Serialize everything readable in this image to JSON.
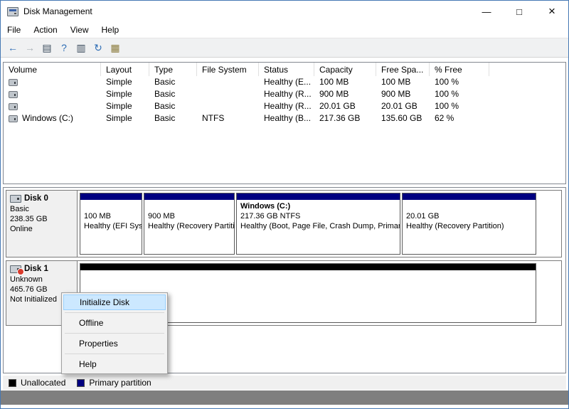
{
  "window": {
    "title": "Disk Management",
    "controls": {
      "minimize": "—",
      "maximize": "□",
      "close": "×"
    }
  },
  "menu_bar": {
    "items": [
      "File",
      "Action",
      "View",
      "Help"
    ]
  },
  "toolbar": {
    "icons": [
      {
        "name": "back",
        "glyph": "←"
      },
      {
        "name": "forward",
        "glyph": "→"
      },
      {
        "name": "show-console-tree",
        "glyph": "▤"
      },
      {
        "name": "help",
        "glyph": "?"
      },
      {
        "name": "show-action-pane",
        "glyph": "▥"
      },
      {
        "name": "refresh",
        "glyph": "↻"
      },
      {
        "name": "disk-properties",
        "glyph": "▦"
      }
    ]
  },
  "volume_table": {
    "columns": [
      "Volume",
      "Layout",
      "Type",
      "File System",
      "Status",
      "Capacity",
      "Free Spa...",
      "% Free"
    ],
    "rows": [
      [
        "",
        "Simple",
        "Basic",
        "",
        "Healthy (E...",
        "100 MB",
        "100 MB",
        "100 %"
      ],
      [
        "",
        "Simple",
        "Basic",
        "",
        "Healthy (R...",
        "900 MB",
        "900 MB",
        "100 %"
      ],
      [
        "",
        "Simple",
        "Basic",
        "",
        "Healthy (R...",
        "20.01 GB",
        "20.01 GB",
        "100 %"
      ],
      [
        "Windows (C:)",
        "Simple",
        "Basic",
        "NTFS",
        "Healthy (B...",
        "217.36 GB",
        "135.60 GB",
        "62 %"
      ]
    ]
  },
  "disks": [
    {
      "name": "Disk 0",
      "type": "Basic",
      "size": "238.35 GB",
      "status": "Online",
      "partitions": [
        {
          "title": "",
          "size": "100 MB",
          "status": "Healthy (EFI System Partition)"
        },
        {
          "title": "",
          "size": "900 MB",
          "status": "Healthy (Recovery Partition)"
        },
        {
          "title": "Windows  (C:)",
          "size": "217.36 GB NTFS",
          "status": "Healthy (Boot, Page File, Crash Dump, Primary Partition)"
        },
        {
          "title": "",
          "size": "20.01 GB",
          "status": "Healthy (Recovery Partition)"
        }
      ]
    },
    {
      "name": "Disk 1",
      "type": "Unknown",
      "size": "465.76 GB",
      "status": "Not Initialized"
    }
  ],
  "context_menu": {
    "items": [
      "Initialize Disk",
      "Offline",
      "Properties",
      "Help"
    ],
    "highlighted": "Initialize Disk"
  },
  "legend": {
    "items": [
      {
        "label": "Unallocated",
        "color": "#000000"
      },
      {
        "label": "Primary partition",
        "color": "#000080"
      }
    ]
  },
  "colors": {
    "primary_partition_band": "#000080",
    "unallocated_band": "#000000",
    "menu_highlight": "#cce8ff",
    "menu_highlight_border": "#99d1ff",
    "window_border": "#4678b4"
  }
}
